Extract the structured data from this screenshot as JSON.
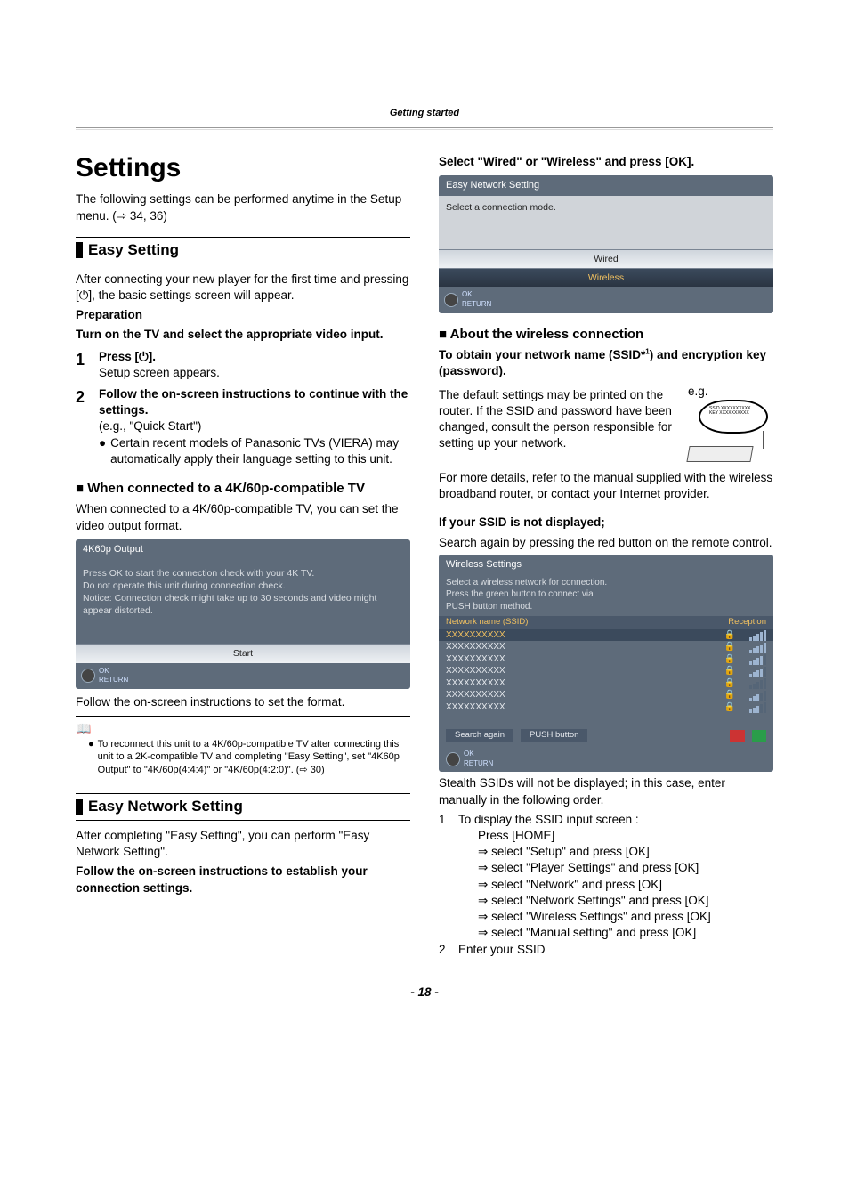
{
  "headerBand": "Getting started",
  "pageTitle": "Settings",
  "introText": "The following settings can be performed anytime in the Setup menu. (⇨ 34, 36)",
  "sec1": {
    "title": "Easy Setting",
    "body1": "After connecting your new player for the first time and pressing [⏻], the basic settings screen will appear.",
    "prepLabel": "Preparation",
    "prepText": "Turn on the TV and select the appropriate video input.",
    "step1": {
      "n": "1",
      "line1": "Press [",
      "line2": "].",
      "after": "Setup screen appears."
    },
    "step2": {
      "n": "2",
      "line1": "Follow the on-screen instructions to continue with the settings.",
      "eg": "(e.g., \"Quick Start\")",
      "bullet": "Certain recent models of Panasonic TVs (VIERA) may automatically apply their language setting to this unit."
    },
    "sub4k": {
      "title": "When connected to a 4K/60p-compatible TV",
      "body": "When connected to a 4K/60p-compatible TV, you can set the video output format.",
      "dlgTitle": "4K60p Output",
      "dlgMsg": "Press OK to start the connection check with your 4K TV.\nDo not operate this unit during connection check.\nNotice: Connection check might take up to 30 seconds and video might appear distorted.",
      "dlgBtn": "Start",
      "dlgFoot": "OK\nRETURN",
      "after": "Follow the on-screen instructions to set the format."
    },
    "note": "To reconnect this unit to a 4K/60p-compatible TV after connecting this unit to a 2K-compatible TV and completing \"Easy Setting\", set \"4K60p Output\" to \"4K/60p(4:4:4)\" or \"4K/60p(4:2:0)\". (⇨ 30)"
  },
  "sec2": {
    "title": "Easy Network Setting",
    "body": "After completing \"Easy Setting\", you can perform \"Easy Network Setting\".",
    "bold": "Follow the on-screen instructions to establish your connection settings."
  },
  "right": {
    "selLine": "Select \"Wired\" or \"Wireless\" and press [OK].",
    "ensTitle": "Easy Network Setting",
    "ensMsg": "Select a connection mode.",
    "ensWired": "Wired",
    "ensWireless": "Wireless",
    "ensFoot": "OK\nRETURN",
    "aboutTitle": "About the wireless connection",
    "ssidBold": "To obtain your network name (SSID*",
    "ssidBoldSup": "1",
    "ssidBold2": ") and encryption key (password).",
    "ssidBody": "The default settings may be printed on the router. If the SSID and password have been changed, consult the person responsible for setting up your network.",
    "eg": "e.g.",
    "ssidBody2": "For more details, refer to the manual supplied with the wireless broadband router, or contact your Internet provider.",
    "ifNot": "If your SSID is not displayed;",
    "ifNotBody": "Search again by pressing the red button on the remote control.",
    "wlistTitle": "Wireless Settings",
    "wlistMsg": "Select a wireless network for connection.\nPress the green button to connect via\nPUSH button method.",
    "wlistHdr1": "Network name (SSID)",
    "wlistHdr2": "Reception",
    "wlistRows": [
      {
        "name": "XXXXXXXXXX",
        "lock": true,
        "sig": 5,
        "sel": true
      },
      {
        "name": "XXXXXXXXXX",
        "lock": true,
        "sig": 5
      },
      {
        "name": "XXXXXXXXXX",
        "lock": true,
        "sig": 4
      },
      {
        "name": "XXXXXXXXXX",
        "lock": true,
        "sig": 4
      },
      {
        "name": "XXXXXXXXXX",
        "lock": true,
        "sig": 0
      },
      {
        "name": "XXXXXXXXXX",
        "lock": true,
        "sig": 3
      },
      {
        "name": "XXXXXXXXXX",
        "lock": true,
        "sig": 3
      }
    ],
    "wlistSearch": "Search again",
    "wlistPush": "PUSH button",
    "wlistFoot": "OK\nRETURN",
    "stealth": "Stealth SSIDs will not be displayed; in this case, enter manually in the following order.",
    "steps": [
      {
        "n": "1",
        "t": "To display the SSID input screen :"
      },
      {
        "n": "",
        "t": "Press [HOME]"
      },
      {
        "n": "",
        "arrow": true,
        "t": "select \"Setup\" and press [OK]"
      },
      {
        "n": "",
        "arrow": true,
        "t": "select \"Player Settings\" and press [OK]"
      },
      {
        "n": "",
        "arrow": true,
        "t": "select \"Network\" and press [OK]"
      },
      {
        "n": "",
        "arrow": true,
        "t": "select \"Network Settings\" and press [OK]"
      },
      {
        "n": "",
        "arrow": true,
        "t": "select \"Wireless Settings\" and press [OK]"
      },
      {
        "n": "",
        "arrow": true,
        "t": "select \"Manual setting\" and press [OK]"
      },
      {
        "n": "2",
        "t": "Enter your SSID"
      }
    ],
    "routerLine1": "SSID  XXXXXXXXXX",
    "routerLine2": "KEY  XXXXXXXXXX"
  },
  "pageNum": "- 18 -"
}
